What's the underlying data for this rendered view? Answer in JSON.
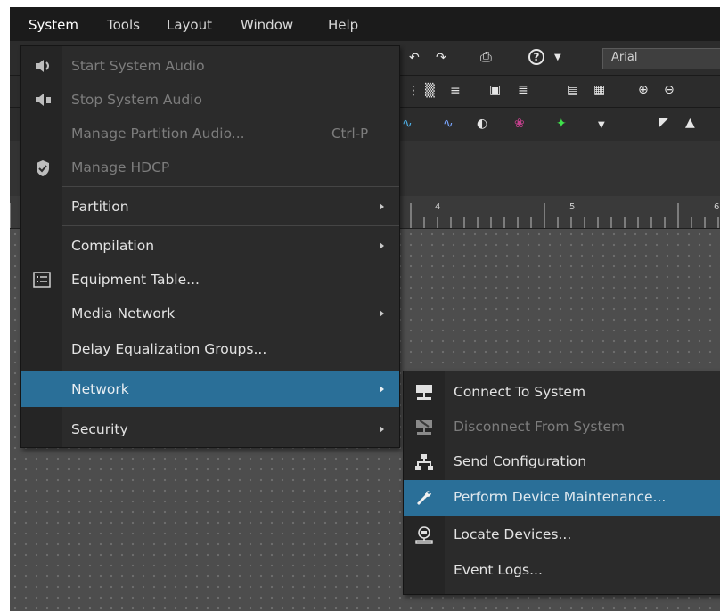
{
  "menubar": {
    "items": [
      "System",
      "Tools",
      "Layout",
      "Window",
      "Help"
    ]
  },
  "toolbar": {
    "font_value": "Arial"
  },
  "ruler": {
    "marks": [
      "4",
      "5",
      "6"
    ]
  },
  "system_menu": {
    "items": [
      {
        "label": "Start System Audio",
        "icon": "speaker-play-icon",
        "enabled": false
      },
      {
        "label": "Stop System Audio",
        "icon": "speaker-stop-icon",
        "enabled": false
      },
      {
        "label": "Manage Partition Audio...",
        "shortcut": "Ctrl-P",
        "enabled": false
      },
      {
        "label": "Manage HDCP",
        "icon": "shield-check-icon",
        "enabled": false
      },
      {
        "label": "Partition",
        "submenu": true
      },
      {
        "label": "Compilation",
        "submenu": true
      },
      {
        "label": "Equipment Table...",
        "icon": "table-list-icon"
      },
      {
        "label": "Media Network",
        "submenu": true
      },
      {
        "label": "Delay Equalization Groups..."
      },
      {
        "label": "Network",
        "submenu": true,
        "selected": true
      },
      {
        "label": "Security",
        "submenu": true
      }
    ]
  },
  "network_menu": {
    "items": [
      {
        "label": "Connect To System",
        "icon": "connect-system-icon"
      },
      {
        "label": "Disconnect From System",
        "icon": "disconnect-system-icon",
        "enabled": false
      },
      {
        "label": "Send Configuration",
        "icon": "network-tree-icon"
      },
      {
        "label": "Perform Device Maintenance...",
        "icon": "wrench-icon",
        "selected": true
      },
      {
        "label": "Locate Devices...",
        "icon": "locate-devices-icon"
      },
      {
        "label": "Event Logs..."
      }
    ]
  },
  "colors": {
    "selection": "#2a6f98",
    "menu_bg": "#2b2b2b",
    "canvas": "#4d4d4d"
  }
}
